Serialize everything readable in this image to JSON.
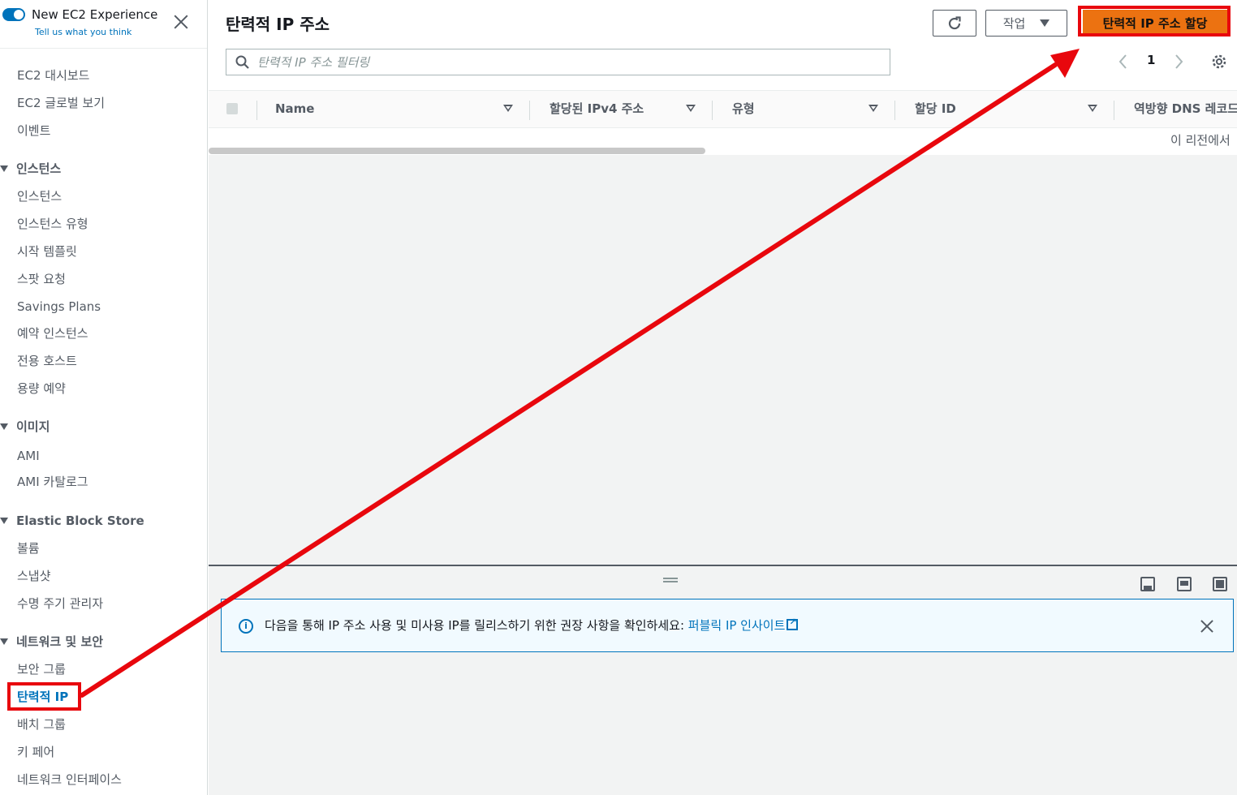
{
  "sidebar": {
    "title": "New EC2 Experience",
    "subtitle": "Tell us what you think",
    "items_top": [
      "EC2 대시보드",
      "EC2 글로벌 보기",
      "이벤트"
    ],
    "sections": [
      {
        "label": "인스턴스",
        "items": [
          "인스턴스",
          "인스턴스 유형",
          "시작 템플릿",
          "스팟 요청",
          "Savings Plans",
          "예약 인스턴스",
          "전용 호스트",
          "용량 예약"
        ]
      },
      {
        "label": "이미지",
        "items": [
          "AMI",
          "AMI 카탈로그"
        ]
      },
      {
        "label": "Elastic Block Store",
        "items": [
          "볼륨",
          "스냅샷",
          "수명 주기 관리자"
        ]
      },
      {
        "label": "네트워크 및 보안",
        "items": [
          "보안 그룹",
          "탄력적 IP",
          "배치 그룹",
          "키 페어",
          "네트워크 인터페이스"
        ]
      }
    ]
  },
  "main": {
    "title": "탄력적 IP 주소",
    "actions_label": "작업",
    "allocate_label": "탄력적 IP 주소 할당",
    "search_placeholder": "탄력적 IP 주소 필터링",
    "page_number": "1",
    "columns": [
      "Name",
      "할당된 IPv4 주소",
      "유형",
      "할당 ID",
      "역방향 DNS 레코드"
    ],
    "empty_message": "이 리전에서",
    "alert": {
      "text": "다음을 통해 IP 주소 사용 및 미사용 IP를 릴리스하기 위한 권장 사항을 확인하세요: ",
      "link": "퍼블릭 IP 인사이트"
    }
  },
  "annotation": {
    "color": "#e8070d"
  },
  "colors": {
    "accent": "#0073bb",
    "primary": "#ec7211"
  }
}
